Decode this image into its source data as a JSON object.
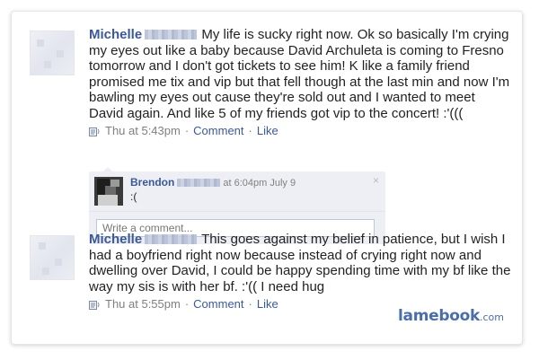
{
  "posts": [
    {
      "author": "Michelle",
      "text": "My life is sucky right now. Ok so basically I'm crying my eyes out like a baby because David Archuleta is coming to Fresno tomorrow and I don't got tickets to see him! K like a family friend promised me tix and vip but that fell though at the last min and now I'm bawling my eyes out cause they're sold out and I wanted to meet David again. And like 5 of my friends got vip to the concert! :'(((",
      "time": "Thu at 5:43pm",
      "comment_label": "Comment",
      "like_label": "Like",
      "separator": "·"
    },
    {
      "author": "Michelle",
      "text": "This goes against my belief in patience, but I wish I had a boyfriend right now because instead of crying right now and dwelling over David, I could be happy spending time with my bf like the way my sis is with her bf. :'(( I need hug",
      "time": "Thu at 5:55pm",
      "comment_label": "Comment",
      "like_label": "Like",
      "separator": "·"
    }
  ],
  "comment": {
    "author": "Brendon",
    "time": "at 6:04pm July 9",
    "text": ":(",
    "close_glyph": "×"
  },
  "write_comment": {
    "placeholder": "Write a comment..."
  },
  "watermark": {
    "brand": "lamebook",
    "suffix": ".com"
  },
  "colors": {
    "link": "#3b5998",
    "meta": "#808080",
    "comment_bg": "#edeff4"
  },
  "icons": {
    "feed": "feed-icon",
    "close": "close-icon"
  }
}
